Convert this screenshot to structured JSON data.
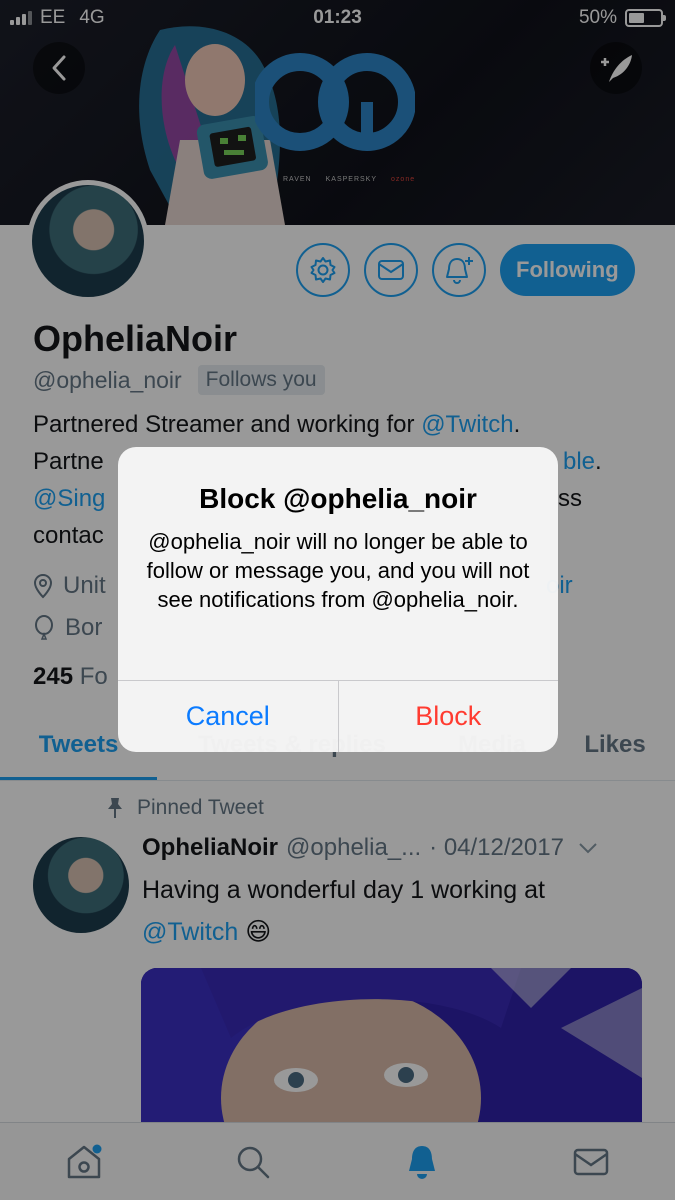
{
  "status_bar": {
    "carrier": "EE",
    "network": "4G",
    "time": "01:23",
    "battery": "50%",
    "battery_level": 0.5
  },
  "banner": {
    "sponsors": [
      "RAVEN",
      "KASPERSKY",
      "ozone"
    ]
  },
  "profile": {
    "display_name": "OpheliaNoir",
    "handle": "@ophelia_noir",
    "follows_you": "Follows you",
    "following_label": "Following",
    "bio_line1_text": "Partnered Streamer and working for ",
    "bio_line1_link": "@Twitch",
    "bio_line1_end": ".",
    "bio_line2_start": "Partne",
    "bio_line2_link": "ble",
    "bio_line2_end": ".",
    "bio_line3_link": "@Sing",
    "bio_line3_end": "ss",
    "bio_line4": "contac",
    "location": "Unit",
    "location_link": "oir",
    "born": "Bor",
    "following_count": "245",
    "following_count_label": "Fo"
  },
  "tabs": [
    "Tweets",
    "Tweets & replies",
    "Media",
    "Likes"
  ],
  "pinned_tweet": {
    "label": "Pinned Tweet",
    "name": "OpheliaNoir",
    "handle": "@ophelia_...",
    "date": "· 04/12/2017",
    "text_line1": "Having a wonderful day 1 working at",
    "text_link": "@Twitch",
    "emoji": "😄"
  },
  "dialog": {
    "title": "Block @ophelia_noir",
    "message": "@ophelia_noir will no longer be able to follow or message you, and you will not see notifications from @ophelia_noir.",
    "cancel": "Cancel",
    "confirm": "Block"
  },
  "colors": {
    "accent": "#1da1f2",
    "destructive": "#ff3b30",
    "ios_blue": "#0b7bff"
  }
}
